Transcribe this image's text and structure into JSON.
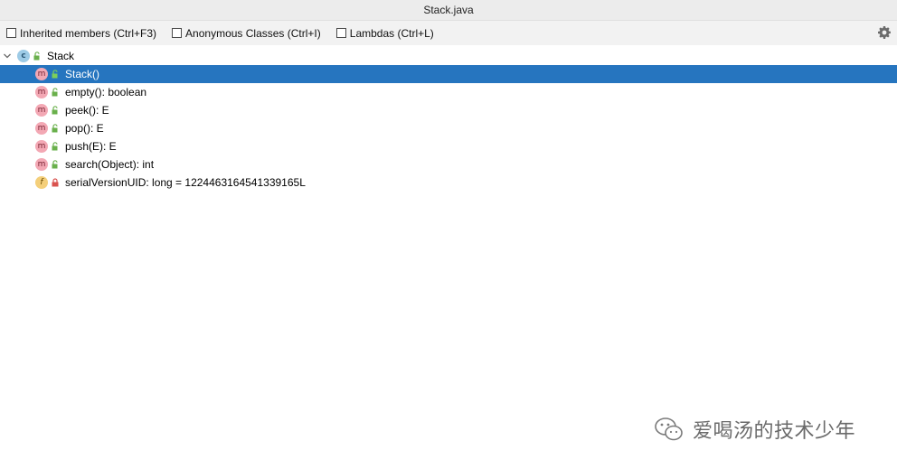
{
  "window": {
    "title": "Stack.java"
  },
  "toolbar": {
    "checkboxes": [
      {
        "label": "Inherited members (Ctrl+F3)",
        "checked": false
      },
      {
        "label": "Anonymous Classes (Ctrl+I)",
        "checked": false
      },
      {
        "label": "Lambdas (Ctrl+L)",
        "checked": false
      }
    ],
    "settings_icon": "gear-icon"
  },
  "tree": {
    "root": {
      "label": "Stack",
      "icon": "class-icon",
      "expanded": true
    },
    "members": [
      {
        "label": "Stack()",
        "icon": "method-icon",
        "visibility": "public",
        "selected": true
      },
      {
        "label": "empty(): boolean",
        "icon": "method-icon",
        "visibility": "public"
      },
      {
        "label": "peek(): E",
        "icon": "method-icon",
        "visibility": "public"
      },
      {
        "label": "pop(): E",
        "icon": "method-icon",
        "visibility": "public"
      },
      {
        "label": "push(E): E",
        "icon": "method-icon",
        "visibility": "public"
      },
      {
        "label": "search(Object): int",
        "icon": "method-icon",
        "visibility": "public"
      },
      {
        "label": "serialVersionUID: long = 1224463164541339165L",
        "icon": "field-icon",
        "visibility": "private"
      }
    ]
  },
  "watermark": {
    "text": "爱喝汤的技术少年"
  },
  "colors": {
    "selection": "#2675bf",
    "method": "#f3a8b4",
    "class": "#9dcbe6",
    "field": "#f4cf7a"
  }
}
